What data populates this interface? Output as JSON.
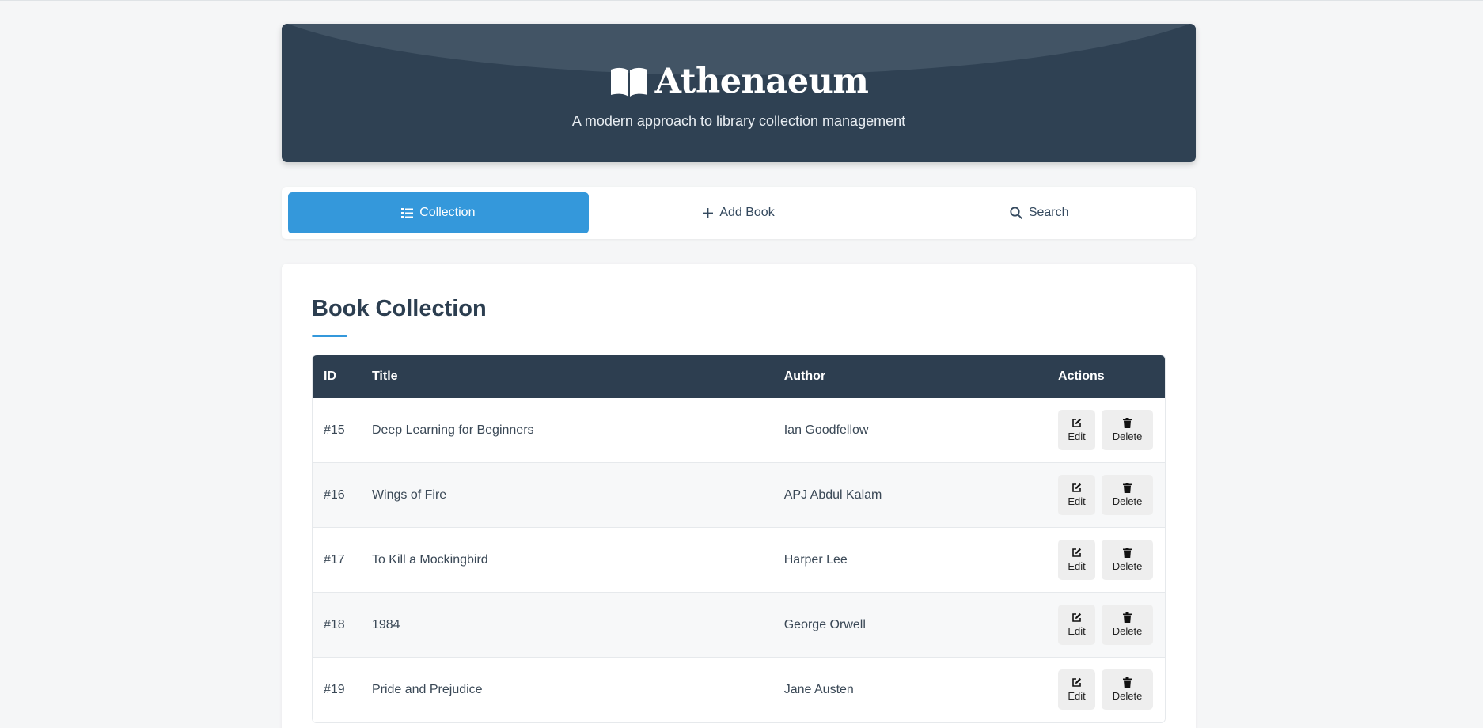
{
  "header": {
    "brand_name": "Athenaeum",
    "tagline": "A modern approach to library collection management",
    "brand_icon": "open-book-icon"
  },
  "nav": {
    "tabs": [
      {
        "label": "Collection",
        "icon": "list-icon",
        "active": true
      },
      {
        "label": "Add Book",
        "icon": "plus-icon",
        "active": false
      },
      {
        "label": "Search",
        "icon": "search-icon",
        "active": false
      }
    ]
  },
  "collection": {
    "title": "Book Collection",
    "columns": [
      "ID",
      "Title",
      "Author",
      "Actions"
    ],
    "rows": [
      {
        "id": "#15",
        "title": "Deep Learning for Beginners",
        "author": "Ian Goodfellow"
      },
      {
        "id": "#16",
        "title": "Wings of Fire",
        "author": "APJ Abdul Kalam"
      },
      {
        "id": "#17",
        "title": "To Kill a Mockingbird",
        "author": "Harper Lee"
      },
      {
        "id": "#18",
        "title": "1984",
        "author": "George Orwell"
      },
      {
        "id": "#19",
        "title": "Pride and Prejudice",
        "author": "Jane Austen"
      }
    ],
    "edit_label": "Edit",
    "delete_label": "Delete"
  },
  "colors": {
    "header_bg": "#2f4153",
    "accent": "#3498db",
    "table_header_bg": "#2d3e50"
  }
}
